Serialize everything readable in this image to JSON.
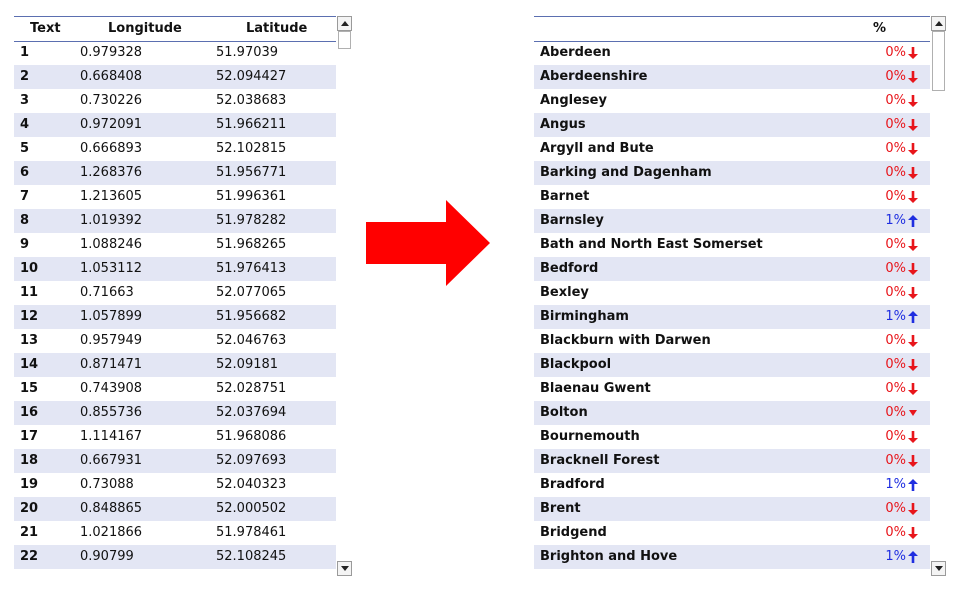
{
  "left_table": {
    "headers": [
      "Text",
      "Longitude",
      "Latitude"
    ],
    "rows": [
      [
        "1",
        "0.979328",
        "51.97039"
      ],
      [
        "2",
        "0.668408",
        "52.094427"
      ],
      [
        "3",
        "0.730226",
        "52.038683"
      ],
      [
        "4",
        "0.972091",
        "51.966211"
      ],
      [
        "5",
        "0.666893",
        "52.102815"
      ],
      [
        "6",
        "1.268376",
        "51.956771"
      ],
      [
        "7",
        "1.213605",
        "51.996361"
      ],
      [
        "8",
        "1.019392",
        "51.978282"
      ],
      [
        "9",
        "1.088246",
        "51.968265"
      ],
      [
        "10",
        "1.053112",
        "51.976413"
      ],
      [
        "11",
        "0.71663",
        "52.077065"
      ],
      [
        "12",
        "1.057899",
        "51.956682"
      ],
      [
        "13",
        "0.957949",
        "52.046763"
      ],
      [
        "14",
        "0.871471",
        "52.09181"
      ],
      [
        "15",
        "0.743908",
        "52.028751"
      ],
      [
        "16",
        "0.855736",
        "52.037694"
      ],
      [
        "17",
        "1.114167",
        "51.968086"
      ],
      [
        "18",
        "0.667931",
        "52.097693"
      ],
      [
        "19",
        "0.73088",
        "52.040323"
      ],
      [
        "20",
        "0.848865",
        "52.000502"
      ],
      [
        "21",
        "1.021866",
        "51.978461"
      ],
      [
        "22",
        "0.90799",
        "52.108245"
      ]
    ],
    "scroll_position": 0
  },
  "arrow": {
    "color": "#ff0000"
  },
  "right_table": {
    "headers": [
      "",
      "%"
    ],
    "rows": [
      {
        "name": "Aberdeen",
        "pct": "0%",
        "trend": "down"
      },
      {
        "name": "Aberdeenshire",
        "pct": "0%",
        "trend": "down"
      },
      {
        "name": "Anglesey",
        "pct": "0%",
        "trend": "down"
      },
      {
        "name": "Angus",
        "pct": "0%",
        "trend": "down"
      },
      {
        "name": "Argyll and Bute",
        "pct": "0%",
        "trend": "down"
      },
      {
        "name": "Barking and Dagenham",
        "pct": "0%",
        "trend": "down"
      },
      {
        "name": "Barnet",
        "pct": "0%",
        "trend": "down"
      },
      {
        "name": "Barnsley",
        "pct": "1%",
        "trend": "up"
      },
      {
        "name": "Bath and North East Somerset",
        "pct": "0%",
        "trend": "down"
      },
      {
        "name": "Bedford",
        "pct": "0%",
        "trend": "down"
      },
      {
        "name": "Bexley",
        "pct": "0%",
        "trend": "down"
      },
      {
        "name": "Birmingham",
        "pct": "1%",
        "trend": "up"
      },
      {
        "name": "Blackburn with Darwen",
        "pct": "0%",
        "trend": "down"
      },
      {
        "name": "Blackpool",
        "pct": "0%",
        "trend": "down"
      },
      {
        "name": "Blaenau Gwent",
        "pct": "0%",
        "trend": "down"
      },
      {
        "name": "Bolton",
        "pct": "0%",
        "trend": "down-small"
      },
      {
        "name": "Bournemouth",
        "pct": "0%",
        "trend": "down"
      },
      {
        "name": "Bracknell Forest",
        "pct": "0%",
        "trend": "down"
      },
      {
        "name": "Bradford",
        "pct": "1%",
        "trend": "up"
      },
      {
        "name": "Brent",
        "pct": "0%",
        "trend": "down"
      },
      {
        "name": "Bridgend",
        "pct": "0%",
        "trend": "down"
      },
      {
        "name": "Brighton and Hove",
        "pct": "1%",
        "trend": "up"
      }
    ],
    "scroll_position": 0
  },
  "colors": {
    "row_alt": "#e3e6f4",
    "header_border": "#5b6fb0",
    "down": "#e8151b",
    "up": "#1f2ee0"
  }
}
